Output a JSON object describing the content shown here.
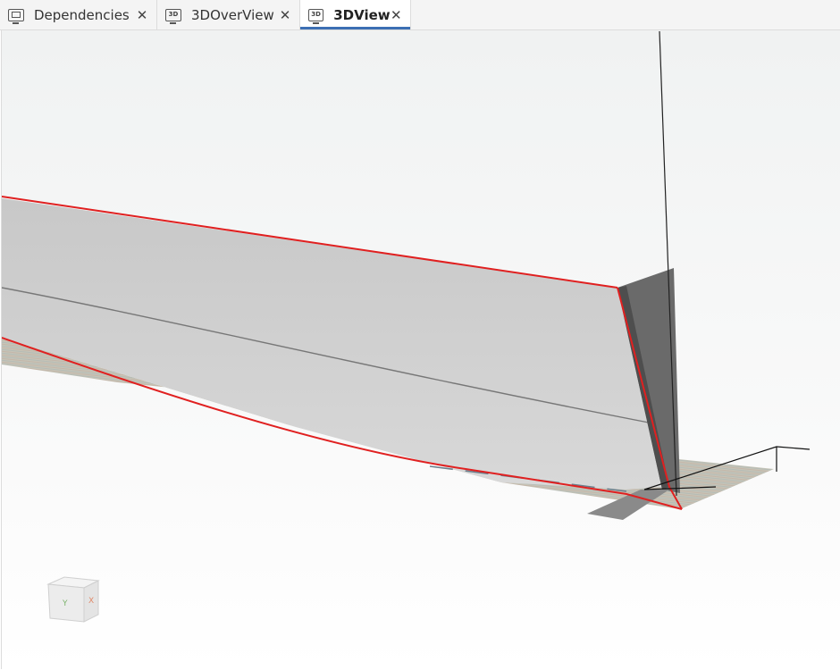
{
  "tabs": [
    {
      "label": "Dependencies",
      "icon": "monitor-icon",
      "active": false
    },
    {
      "label": "3DOverView",
      "icon": "3d-view-icon",
      "icon_text": "3D",
      "active": false
    },
    {
      "label": "3DView",
      "icon": "3d-view-icon",
      "icon_text": "3D",
      "active": true
    }
  ],
  "close_glyph": "✕",
  "nav_cube": {
    "front_label": "Y",
    "side_label": "X"
  },
  "colors": {
    "accent": "#3c6fb4",
    "edge_highlight": "#e02020",
    "hull_fill": "#cfcfcf",
    "transom_fill": "#6a6a6a"
  }
}
